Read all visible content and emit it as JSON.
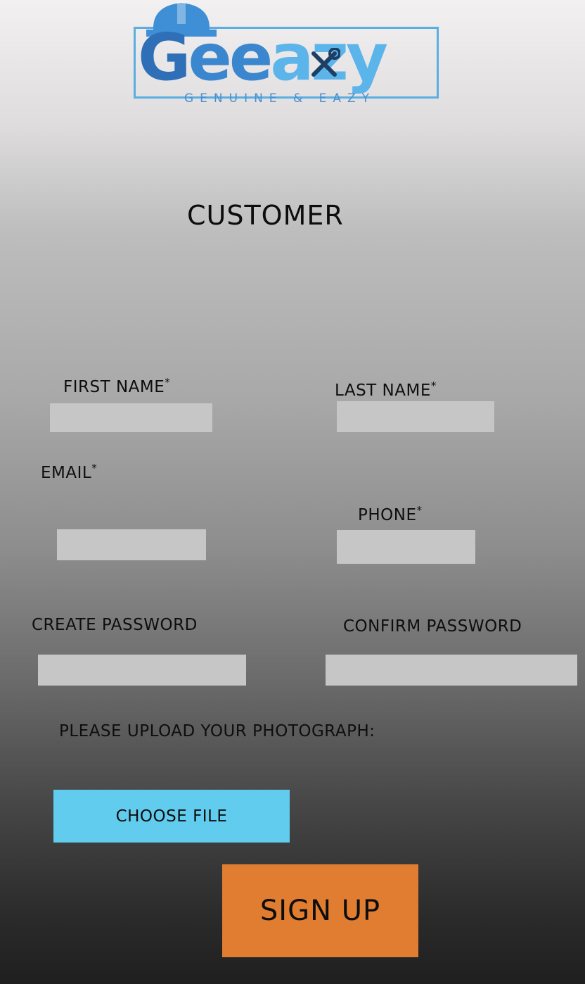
{
  "logo": {
    "wordmark_parts": [
      "G",
      "ee",
      "a",
      "zy"
    ],
    "tagline": "GENUINE & EAZY",
    "colors": {
      "primary": "#2e6fb8",
      "secondary": "#3a86cf",
      "light": "#5bb4ea"
    },
    "icons": [
      "hard-hat-icon",
      "wrench-hammer-icon"
    ]
  },
  "page": {
    "heading": "CUSTOMER"
  },
  "form": {
    "first_name": {
      "label": "FIRST NAME",
      "required_mark": "*",
      "value": ""
    },
    "last_name": {
      "label": "LAST NAME",
      "required_mark": "*",
      "value": ""
    },
    "email": {
      "label": "EMAIL",
      "required_mark": "*",
      "value": ""
    },
    "phone": {
      "label": "PHONE",
      "required_mark": "*",
      "value": ""
    },
    "create_password": {
      "label": "CREATE PASSWORD",
      "value": ""
    },
    "confirm_password": {
      "label": "CONFIRM PASSWORD",
      "value": ""
    },
    "upload": {
      "label": "PLEASE UPLOAD YOUR PHOTOGRAPH:",
      "button_label": "CHOOSE FILE"
    },
    "submit_label": "SIGN UP"
  },
  "colors": {
    "field_bg": "#c6c6c6",
    "choose_file_bg": "#62ccee",
    "sign_up_bg": "#e07d31"
  }
}
